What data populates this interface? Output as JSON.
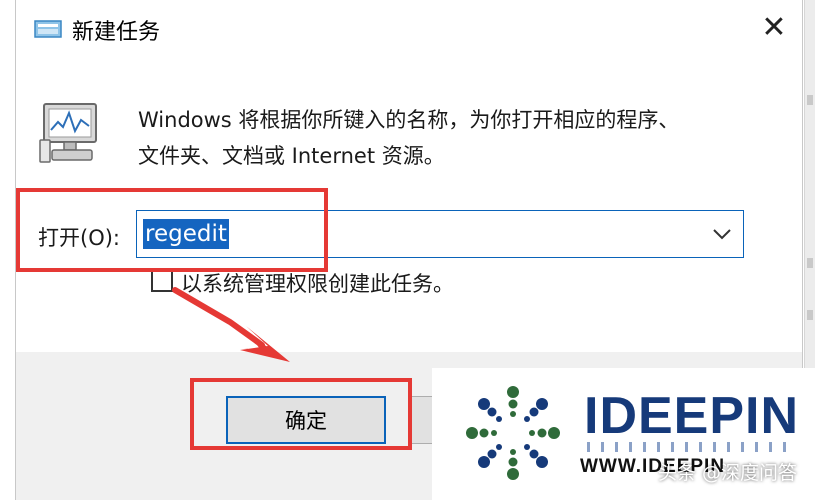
{
  "dialog": {
    "title": "新建任务",
    "close_glyph": "✕",
    "description_line1": "Windows 将根据你所键入的名称，为你打开相应的程序、",
    "description_line2": "文件夹、文档或 Internet 资源。",
    "open_label": "打开(O):",
    "open_value": "regedit",
    "admin_label": "以系统管理权限创建此任务。",
    "admin_checked": false,
    "ok_label": "确定"
  },
  "annotations": {
    "highlight_color": "#e53935"
  },
  "watermark": {
    "brand": "IDEEPIN",
    "url": "WWW.IDEEPIN",
    "credit": "头条 @深度问答"
  },
  "colors": {
    "focus_blue": "#0a63b9",
    "selection_blue": "#1565c0",
    "footer_gray": "#f0f0f0",
    "brand_navy": "#163a7a"
  },
  "icons": [
    "task-icon",
    "run-program-icon",
    "chevron-down-icon",
    "close-icon",
    "ideepin-emblem-icon"
  ]
}
